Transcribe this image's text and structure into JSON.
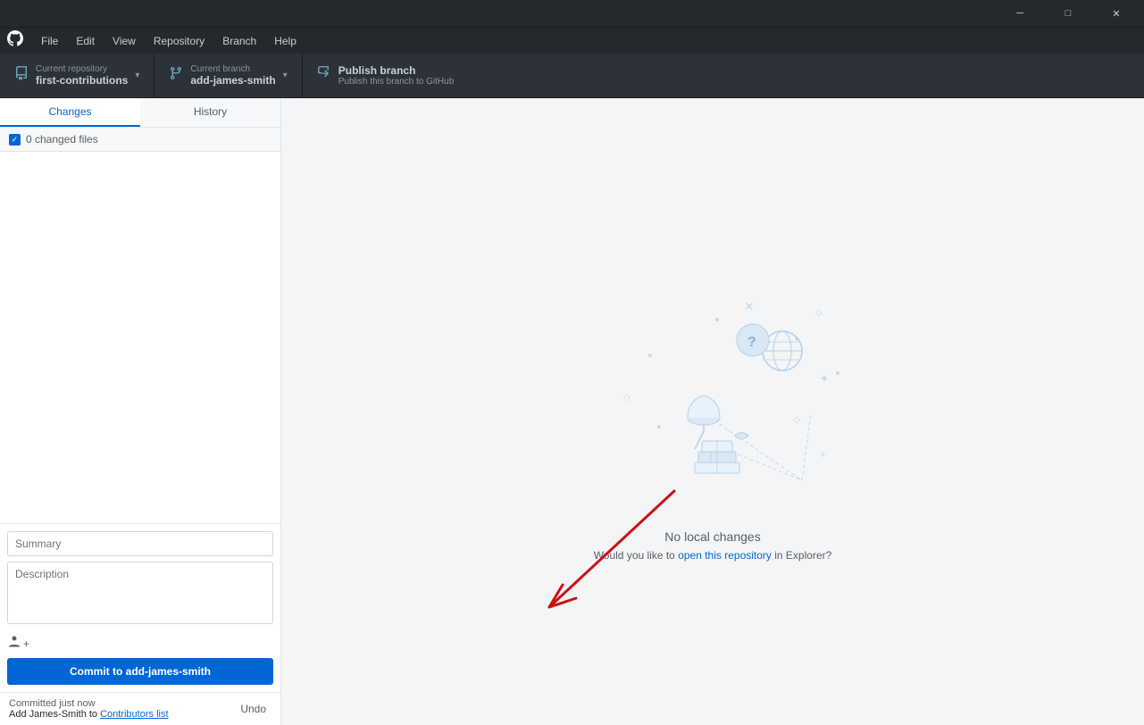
{
  "window": {
    "title_bar": {
      "minimize_label": "─",
      "maximize_label": "□",
      "close_label": "✕"
    }
  },
  "menu": {
    "logo": "⬤",
    "items": [
      {
        "label": "File"
      },
      {
        "label": "Edit"
      },
      {
        "label": "View"
      },
      {
        "label": "Repository"
      },
      {
        "label": "Branch"
      },
      {
        "label": "Help"
      }
    ]
  },
  "toolbar": {
    "current_repo": {
      "label": "Current repository",
      "value": "first-contributions"
    },
    "current_branch": {
      "label": "Current branch",
      "value": "add-james-smith"
    },
    "publish": {
      "label": "Publish branch",
      "sublabel": "Publish this branch to GitHub"
    }
  },
  "sidebar": {
    "tabs": {
      "changes_label": "Changes",
      "history_label": "History"
    },
    "changed_files_label": "0 changed files",
    "commit": {
      "summary_placeholder": "Summary",
      "description_placeholder": "Description",
      "button_prefix": "Commit to ",
      "button_branch": "add-james-smith"
    },
    "recent_commit": {
      "time": "Committed just now",
      "message": "Add James-Smith to Contributors list",
      "message_link": "Contributors list",
      "undo_label": "Undo"
    }
  },
  "main": {
    "no_changes_title": "No local changes",
    "no_changes_sub_before": "Would you like to ",
    "no_changes_link": "open this repository",
    "no_changes_sub_after": " in Explorer?"
  }
}
